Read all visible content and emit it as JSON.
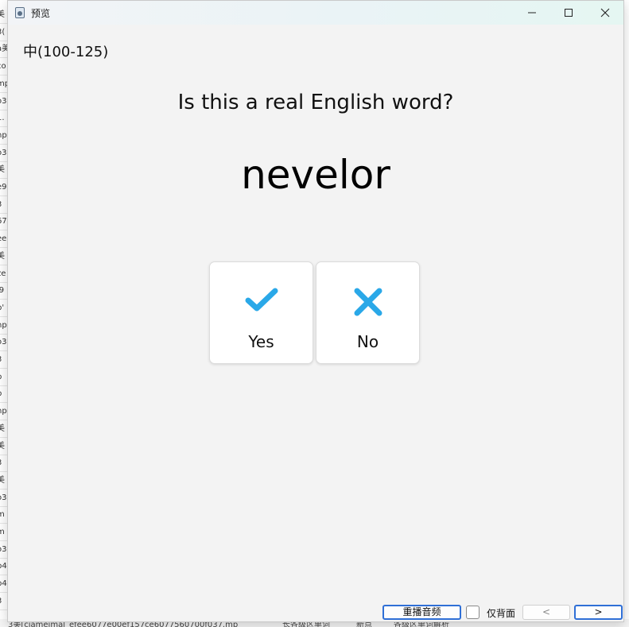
{
  "background_app": {
    "left_column_fragments": [
      "美",
      "3(",
      "a美",
      "co",
      "mp",
      "o3",
      "1.",
      "np",
      "o3",
      "美",
      "e9",
      "3 ",
      "67",
      "ee",
      "美",
      "ze",
      "l9",
      "b'",
      "np",
      "o3",
      "3 ",
      "p",
      "p",
      "np",
      "美",
      "美",
      "3 ",
      "美",
      "o3",
      "m",
      "m",
      "o3",
      "b4",
      "b4",
      "3 "
    ],
    "bottom_row_fragments": [
      "3美[ciameimal_efee6077e00ef157ce6077560700f037.mp",
      "长各级区单词",
      "新点",
      "各级区单词解析"
    ]
  },
  "window": {
    "title": "预览",
    "icon": "app-icon",
    "controls": [
      "minimize-icon",
      "maximize-icon",
      "close-icon"
    ]
  },
  "content": {
    "level_label": "中(100-125)",
    "question": "Is this a real English word?",
    "word": "nevelor",
    "answers": [
      {
        "label": "Yes",
        "icon": "check-icon",
        "color": "#2aa8e8"
      },
      {
        "label": "No",
        "icon": "cross-icon",
        "color": "#2aa8e8"
      }
    ]
  },
  "footer": {
    "replay_audio": "重播音频",
    "back_only_label": "仅背面",
    "back_only_checked": false,
    "prev": "<",
    "next": ">"
  },
  "colors": {
    "accent": "#2aa8e8",
    "primary_border": "#2f6fd6",
    "window_bg": "#f3f3f3"
  }
}
